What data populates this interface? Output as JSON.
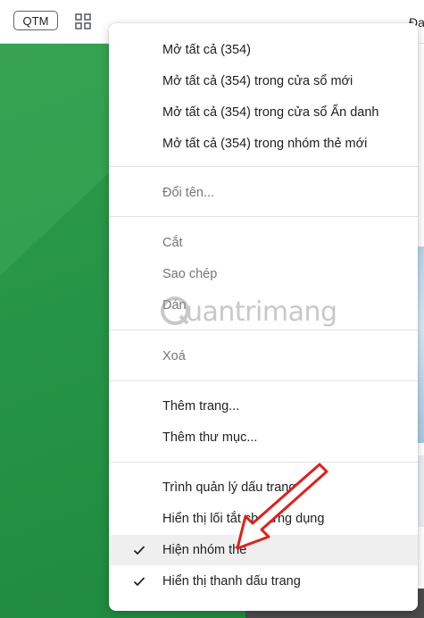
{
  "bookmark_bar": {
    "chip_label": "QTM",
    "apps_icon": "grid-icon",
    "peek_text": "Đa"
  },
  "context_menu": {
    "groups": [
      {
        "items": [
          {
            "label": "Mở tất cả (354)",
            "enabled": true
          },
          {
            "label": "Mở tất cả (354) trong cửa sổ mới",
            "enabled": true
          },
          {
            "label": "Mở tất cả (354) trong cửa sổ Ẩn danh",
            "enabled": true
          },
          {
            "label": "Mở tất cả (354) trong nhóm thẻ mới",
            "enabled": true
          }
        ]
      },
      {
        "items": [
          {
            "label": "Đổi tên...",
            "enabled": false
          }
        ]
      },
      {
        "items": [
          {
            "label": "Cắt",
            "enabled": false
          },
          {
            "label": "Sao chép",
            "enabled": false
          },
          {
            "label": "Dán",
            "enabled": false
          }
        ]
      },
      {
        "items": [
          {
            "label": "Xoá",
            "enabled": false
          }
        ]
      },
      {
        "items": [
          {
            "label": "Thêm trang...",
            "enabled": true
          },
          {
            "label": "Thêm thư mục...",
            "enabled": true
          }
        ]
      },
      {
        "items": [
          {
            "label": "Trình quản lý dấu trang",
            "enabled": true
          },
          {
            "label": "Hiển thị lối tắt cho ứng dụng",
            "enabled": true
          },
          {
            "label": "Hiện nhóm thẻ",
            "enabled": true,
            "checked": true,
            "highlighted": true
          },
          {
            "label": "Hiển thị thanh dấu trang",
            "enabled": true,
            "checked": true
          }
        ]
      }
    ]
  },
  "watermark": {
    "text": "uantrimang"
  },
  "colors": {
    "arrow": "#e0201b",
    "menu_text": "#202124",
    "menu_text_disabled": "#757575",
    "highlight": "#efefef",
    "page_green": "#269446"
  }
}
